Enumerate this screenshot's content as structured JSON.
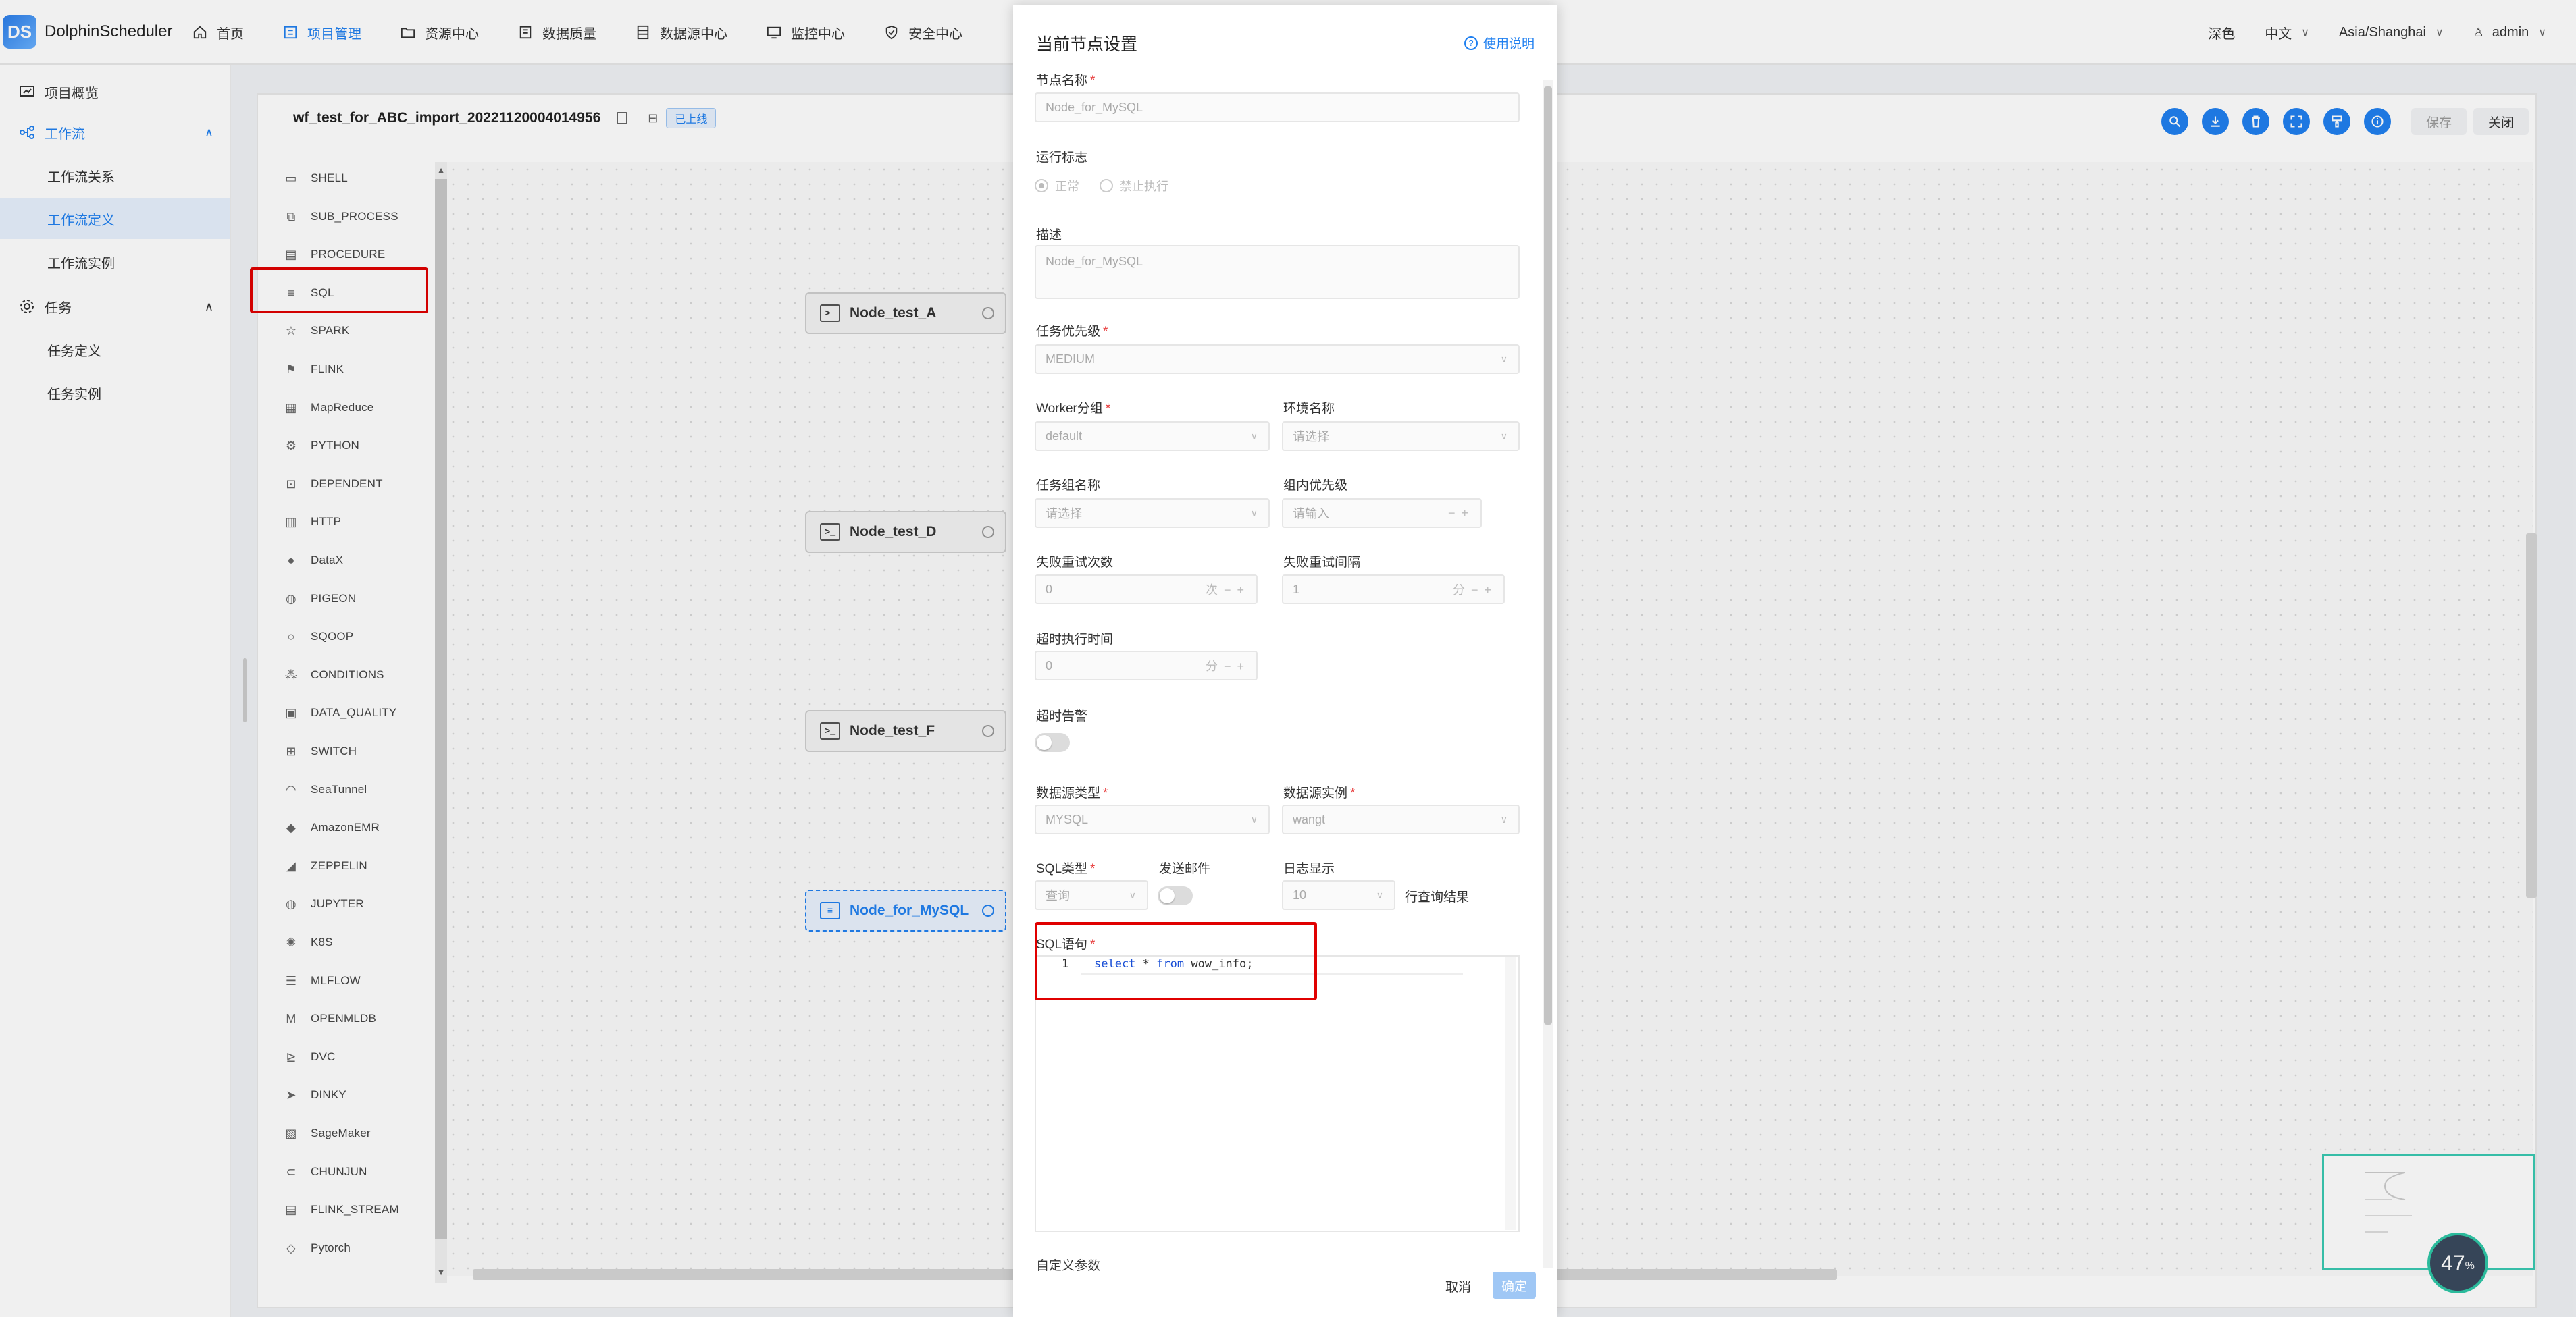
{
  "app": {
    "logo_text": "DolphinScheduler",
    "logo_mark": "DS"
  },
  "nav": [
    {
      "label": "首页",
      "icon": "home-icon"
    },
    {
      "label": "项目管理",
      "icon": "project-icon"
    },
    {
      "label": "资源中心",
      "icon": "folder-icon"
    },
    {
      "label": "数据质量",
      "icon": "data-quality-icon"
    },
    {
      "label": "数据源中心",
      "icon": "datasource-icon"
    },
    {
      "label": "监控中心",
      "icon": "monitor-icon"
    },
    {
      "label": "安全中心",
      "icon": "shield-icon"
    }
  ],
  "header_right": {
    "theme": "深色",
    "lang": "中文",
    "timezone": "Asia/Shanghai",
    "user": "admin"
  },
  "sidebar": {
    "overview": "项目概览",
    "workflow": "工作流",
    "workflow_relation": "工作流关系",
    "workflow_definition": "工作流定义",
    "workflow_instance": "工作流实例",
    "task": "任务",
    "task_definition": "任务定义",
    "task_instance": "任务实例"
  },
  "workflow": {
    "name": "wf_test_for_ABC_import_20221120004014956",
    "status_badge": "已上线"
  },
  "toolbar": {
    "save": "保存",
    "close": "关闭"
  },
  "palette": [
    "SHELL",
    "SUB_PROCESS",
    "PROCEDURE",
    "SQL",
    "SPARK",
    "FLINK",
    "MapReduce",
    "PYTHON",
    "DEPENDENT",
    "HTTP",
    "DataX",
    "PIGEON",
    "SQOOP",
    "CONDITIONS",
    "DATA_QUALITY",
    "SWITCH",
    "SeaTunnel",
    "AmazonEMR",
    "ZEPPELIN",
    "JUPYTER",
    "K8S",
    "MLFLOW",
    "OPENMLDB",
    "DVC",
    "DINKY",
    "SageMaker",
    "CHUNJUN",
    "FLINK_STREAM",
    "Pytorch"
  ],
  "nodes": [
    "Node_test_A",
    "Node_test_D",
    "Node_test_F",
    "Node_for_MySQL"
  ],
  "zoom": "47",
  "zoom_unit": "%",
  "drawer": {
    "title": "当前节点设置",
    "help": "使用说明",
    "node_name_label": "节点名称",
    "node_name_placeholder": "Node_for_MySQL",
    "run_flag_label": "运行标志",
    "run_flag_normal": "正常",
    "run_flag_forbid": "禁止执行",
    "desc_label": "描述",
    "desc_placeholder": "Node_for_MySQL",
    "priority_label": "任务优先级",
    "priority_value": "MEDIUM",
    "worker_group_label": "Worker分组",
    "worker_group_value": "default",
    "env_label": "环境名称",
    "env_placeholder": "请选择",
    "task_group_label": "任务组名称",
    "task_group_placeholder": "请选择",
    "group_priority_label": "组内优先级",
    "group_priority_placeholder": "请输入",
    "retry_times_label": "失败重试次数",
    "retry_times_value": "0",
    "retry_times_unit": "次",
    "retry_interval_label": "失败重试间隔",
    "retry_interval_value": "1",
    "retry_interval_unit": "分",
    "timeout_label": "超时执行时间",
    "timeout_value": "0",
    "timeout_unit": "分",
    "timeout_alarm_label": "超时告警",
    "ds_type_label": "数据源类型",
    "ds_type_value": "MYSQL",
    "ds_instance_label": "数据源实例",
    "ds_instance_value": "wangt",
    "sql_type_label": "SQL类型",
    "sql_type_value": "查询",
    "send_email_label": "发送邮件",
    "log_display_label": "日志显示",
    "log_display_value": "10",
    "log_display_suffix": "行查询结果",
    "sql_label": "SQL语句",
    "sql_line_no": "1",
    "sql_select": "select",
    "sql_star": " * ",
    "sql_from": "from",
    "sql_rest": " wow_info;",
    "custom_params_label": "自定义参数",
    "cancel": "取消",
    "ok": "确定"
  }
}
